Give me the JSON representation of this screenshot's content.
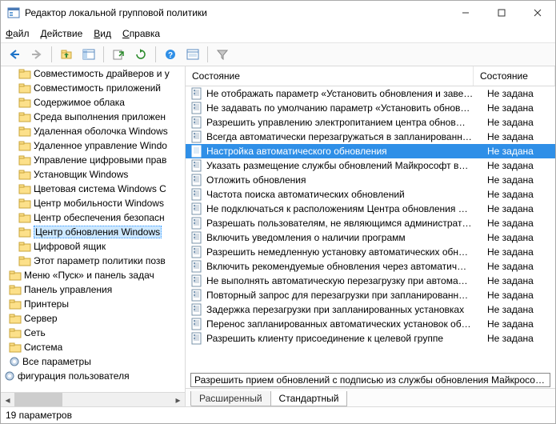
{
  "window": {
    "title": "Редактор локальной групповой политики"
  },
  "menu": {
    "file": "Файл",
    "action": "Действие",
    "view": "Вид",
    "help": "Справка",
    "file_u": "Ф",
    "action_u": "Д",
    "view_u": "В",
    "help_u": "С"
  },
  "tree": {
    "items": [
      {
        "label": "Совместимость драйверов и у",
        "type": "folder",
        "indent": 18
      },
      {
        "label": "Совместимость приложений",
        "type": "folder",
        "indent": 18
      },
      {
        "label": "Содержимое облака",
        "type": "folder",
        "indent": 18
      },
      {
        "label": "Среда выполнения приложен",
        "type": "folder",
        "indent": 18
      },
      {
        "label": "Удаленная оболочка Windows",
        "type": "folder",
        "indent": 18
      },
      {
        "label": "Удаленное управление Windo",
        "type": "folder",
        "indent": 18
      },
      {
        "label": "Управление цифровыми прав",
        "type": "folder",
        "indent": 18
      },
      {
        "label": "Установщик Windows",
        "type": "folder",
        "indent": 18
      },
      {
        "label": "Цветовая система Windows C",
        "type": "folder",
        "indent": 18
      },
      {
        "label": "Центр мобильности Windows",
        "type": "folder",
        "indent": 18
      },
      {
        "label": "Центр обеспечения безопасн",
        "type": "folder",
        "indent": 18
      },
      {
        "label": "Центр обновления Windows",
        "type": "folder",
        "indent": 18,
        "selected": true
      },
      {
        "label": "Цифровой ящик",
        "type": "folder",
        "indent": 18
      },
      {
        "label": "Этот параметр политики позв",
        "type": "folder",
        "indent": 18
      },
      {
        "label": "Меню «Пуск» и панель задач",
        "type": "folder",
        "indent": 6
      },
      {
        "label": "Панель управления",
        "type": "folder",
        "indent": 6
      },
      {
        "label": "Принтеры",
        "type": "folder",
        "indent": 6
      },
      {
        "label": "Сервер",
        "type": "folder",
        "indent": 6
      },
      {
        "label": "Сеть",
        "type": "folder",
        "indent": 6
      },
      {
        "label": "Система",
        "type": "folder",
        "indent": 6
      },
      {
        "label": "Все параметры",
        "type": "cog",
        "indent": 6
      },
      {
        "label": "фигурация пользователя",
        "type": "cog",
        "indent": 0
      }
    ]
  },
  "list": {
    "col_name": "Состояние",
    "col_state": "Состояние",
    "rows": [
      {
        "name": "Не отображать параметр «Установить обновления и заве…",
        "state": "Не задана"
      },
      {
        "name": "Не задавать по умолчанию параметр «Установить обнов…",
        "state": "Не задана"
      },
      {
        "name": "Разрешить управлению электропитанием центра обнов…",
        "state": "Не задана"
      },
      {
        "name": "Всегда автоматически перезагружаться в запланированн…",
        "state": "Не задана"
      },
      {
        "name": "Настройка автоматического обновления",
        "state": "Не задана",
        "selected": true
      },
      {
        "name": "Указать размещение службы обновлений Майкрософт в…",
        "state": "Не задана"
      },
      {
        "name": "Отложить обновления",
        "state": "Не задана"
      },
      {
        "name": "Частота поиска автоматических обновлений",
        "state": "Не задана"
      },
      {
        "name": "Не подключаться к расположениям Центра обновления …",
        "state": "Не задана"
      },
      {
        "name": "Разрешать пользователям, не являющимся администрат…",
        "state": "Не задана"
      },
      {
        "name": "Включить уведомления о наличии программ",
        "state": "Не задана"
      },
      {
        "name": "Разрешить немедленную установку автоматических обн…",
        "state": "Не задана"
      },
      {
        "name": "Включить рекомендуемые обновления через автоматич…",
        "state": "Не задана"
      },
      {
        "name": "Не выполнять автоматическую перезагрузку при автома…",
        "state": "Не задана"
      },
      {
        "name": "Повторный запрос для перезагрузки при запланированн…",
        "state": "Не задана"
      },
      {
        "name": "Задержка перезагрузки при запланированных установках",
        "state": "Не задана"
      },
      {
        "name": "Перенос запланированных автоматических установок об…",
        "state": "Не задана"
      },
      {
        "name": "Разрешить клиенту присоединение к целевой группе",
        "state": "Не задана"
      }
    ],
    "tooltip": "Разрешить прием обновлений с подписью из службы обновления Майкрософт в"
  },
  "tabs": {
    "extended": "Расширенный",
    "standard": "Стандартный"
  },
  "status": {
    "text": "19 параметров"
  }
}
